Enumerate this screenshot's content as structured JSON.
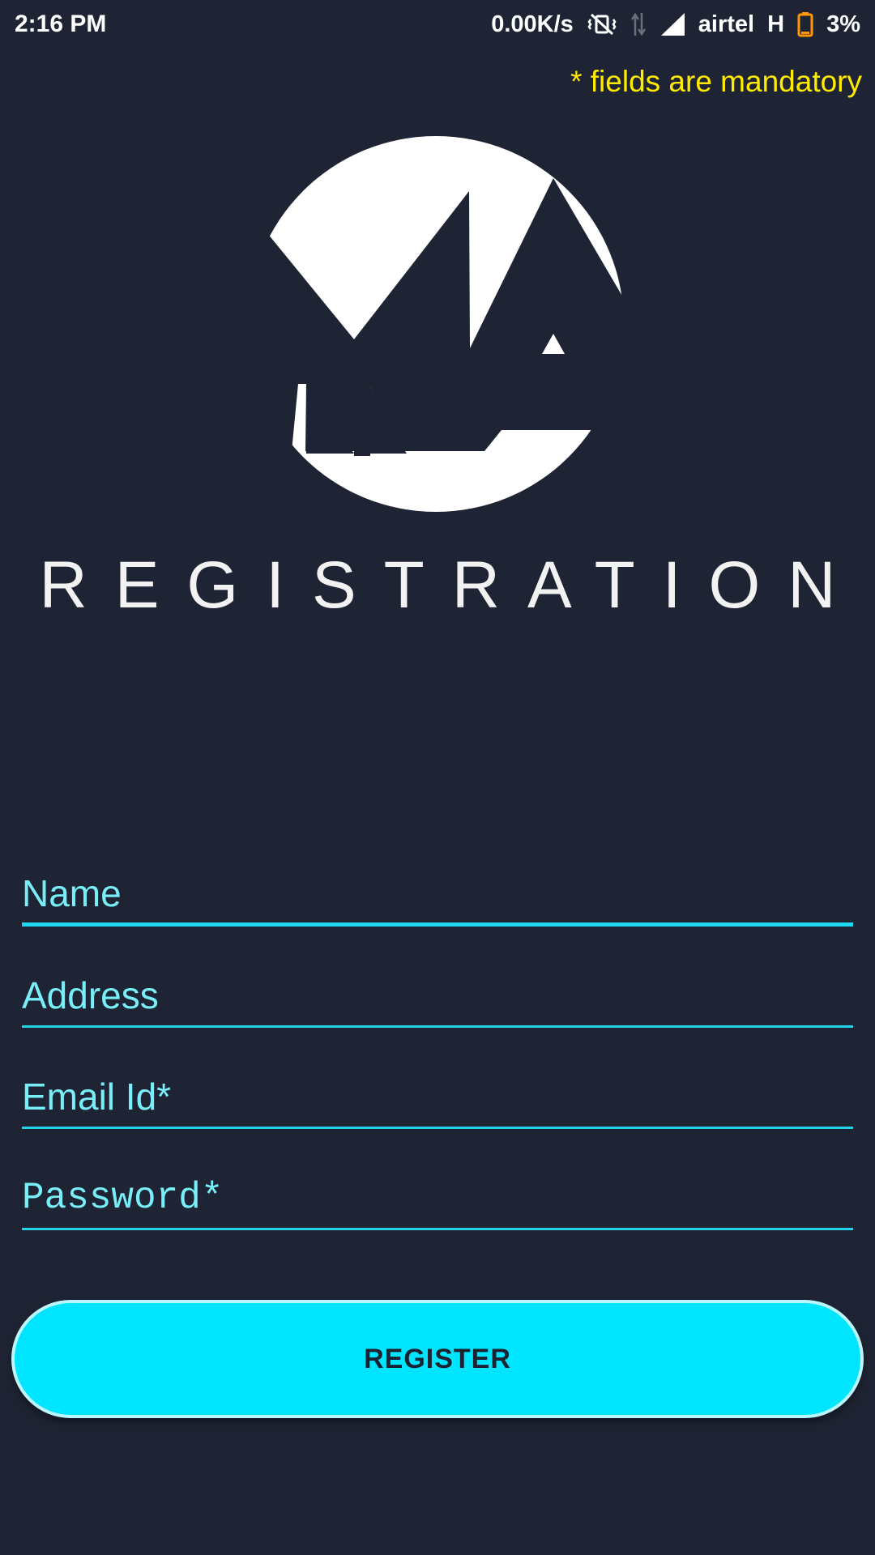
{
  "status_bar": {
    "time": "2:16 PM",
    "network_speed": "0.00K/s",
    "carrier": "airtel",
    "network_type": "H",
    "battery_percent": "3%",
    "icons": [
      "vibrate-off-icon",
      "data-transfer-icon",
      "signal-icon",
      "battery-low-icon"
    ],
    "battery_color": "#ff9800"
  },
  "header": {
    "mandatory_note": "* fields are mandatory",
    "mandatory_note_color": "#ffeb00"
  },
  "logo": {
    "icon": "mountain-logo-icon"
  },
  "title": "REGISTRATION",
  "form": {
    "name": {
      "placeholder": "Name",
      "value": ""
    },
    "address": {
      "placeholder": "Address",
      "value": ""
    },
    "email": {
      "placeholder": "Email Id*",
      "value": ""
    },
    "password": {
      "placeholder": "Password*",
      "value": ""
    }
  },
  "register_button": {
    "label": "REGISTER",
    "color": "#00e5ff"
  },
  "colors": {
    "background": "#1f2434",
    "accent": "#20d3e6"
  }
}
